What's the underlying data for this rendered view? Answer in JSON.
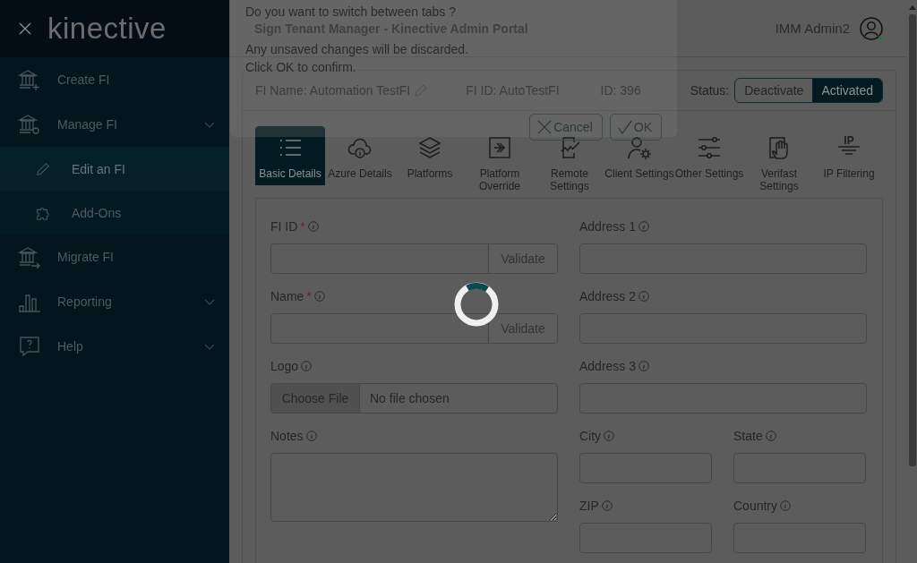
{
  "sidebar": {
    "logo": "kinective",
    "items": [
      {
        "label": "Create FI",
        "kind": "link"
      },
      {
        "label": "Manage FI",
        "kind": "menu",
        "children": [
          {
            "label": "Edit an FI",
            "selected": true
          },
          {
            "label": "Add-Ons",
            "selected": false
          }
        ]
      },
      {
        "label": "Migrate FI",
        "kind": "link"
      },
      {
        "label": "Reporting",
        "kind": "menu"
      },
      {
        "label": "Help",
        "kind": "menu"
      }
    ]
  },
  "header": {
    "title": "Sign Tenant Manager - Kinective Admin Portal",
    "user": "IMM Admin2",
    "online": true
  },
  "dialog": {
    "lines": [
      "Do you want to switch between tabs ?",
      "Any unsaved changes will be discarded.",
      "Click OK to confirm."
    ],
    "cancel": "Cancel",
    "ok": "OK"
  },
  "card": {
    "fi_name": "FI Name: Automation TestFI",
    "fi_id": "FI ID: AutoTestFI",
    "id": "ID: 396",
    "status_label": "Status:",
    "status_options": [
      {
        "label": "Deactivate",
        "selected": false
      },
      {
        "label": "Activated",
        "selected": true
      }
    ]
  },
  "tabs": [
    {
      "label": "Basic Details",
      "selected": true
    },
    {
      "label": "Azure Details",
      "selected": false
    },
    {
      "label": "Platforms",
      "selected": false
    },
    {
      "label": "Platform Override",
      "selected": false
    },
    {
      "label": "Remote Settings",
      "selected": false
    },
    {
      "label": "Client Settings",
      "selected": false
    },
    {
      "label": "Other Settings",
      "selected": false
    },
    {
      "label": "Verifast Settings",
      "selected": false
    },
    {
      "label": "IP Filtering",
      "selected": false,
      "icon_text": "IP"
    }
  ],
  "form": {
    "loading": true,
    "left_fields": [
      {
        "label": "FI ID",
        "required_mark": "*",
        "kind": "validate",
        "button": "Validate"
      },
      {
        "label": "Name",
        "required_mark": "*",
        "kind": "validate",
        "button": "Validate"
      },
      {
        "label": "Logo",
        "kind": "file",
        "button": "Choose File",
        "value": "No file chosen"
      },
      {
        "label": "Notes",
        "kind": "textarea"
      }
    ],
    "right_fields": [
      {
        "label": "Address 1",
        "kind": "wide"
      },
      {
        "label": "Address 2",
        "kind": "wide"
      },
      {
        "label": "Address 3",
        "kind": "wide"
      },
      {
        "label": "City",
        "kind": "half"
      },
      {
        "label": "State",
        "kind": "half"
      },
      {
        "label": "ZIP",
        "kind": "half"
      },
      {
        "label": "Country",
        "kind": "half"
      }
    ]
  }
}
